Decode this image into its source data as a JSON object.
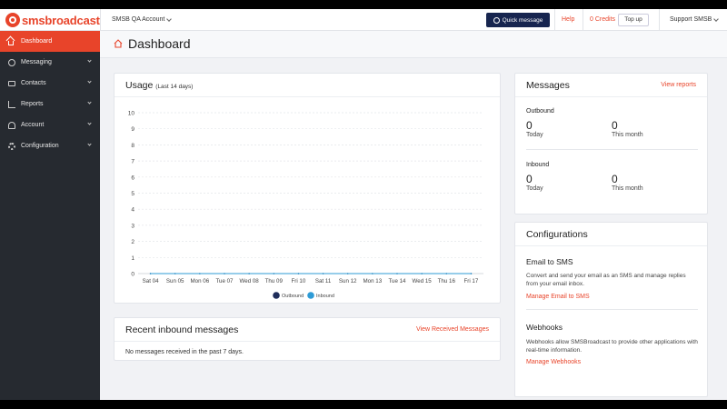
{
  "topbar": {
    "logo_sms": "sms",
    "logo_rest": "broadcast",
    "account": "SMSB QA Account",
    "quick_message": "Quick message",
    "help": "Help",
    "credits": "0 Credits",
    "top_up": "Top up",
    "support": "Support SMSB"
  },
  "sidebar": {
    "items": [
      {
        "label": "Dashboard",
        "icon": "home-icon"
      },
      {
        "label": "Messaging",
        "icon": "message-icon"
      },
      {
        "label": "Contacts",
        "icon": "contacts-icon"
      },
      {
        "label": "Reports",
        "icon": "reports-icon"
      },
      {
        "label": "Account",
        "icon": "user-icon"
      },
      {
        "label": "Configuration",
        "icon": "gear-icon"
      }
    ]
  },
  "page": {
    "title": "Dashboard"
  },
  "usage": {
    "title": "Usage",
    "subtitle": "(Last 14 days)"
  },
  "chart_data": {
    "type": "line",
    "x": [
      "Sat 04",
      "Sun 05",
      "Mon 06",
      "Tue 07",
      "Wed 08",
      "Thu 09",
      "Fri 10",
      "Sat 11",
      "Sun 12",
      "Mon 13",
      "Tue 14",
      "Wed 15",
      "Thu 16",
      "Fri 17"
    ],
    "series": [
      {
        "name": "Outbound",
        "values": [
          0,
          0,
          0,
          0,
          0,
          0,
          0,
          0,
          0,
          0,
          0,
          0,
          0,
          0
        ],
        "color": "#1f2d5a"
      },
      {
        "name": "Inbound",
        "values": [
          0,
          0,
          0,
          0,
          0,
          0,
          0,
          0,
          0,
          0,
          0,
          0,
          0,
          0
        ],
        "color": "#2e9bd6"
      }
    ],
    "ylim": [
      0,
      10
    ],
    "yticks": [
      "0",
      "1",
      "2",
      "3",
      "4",
      "5",
      "6",
      "7",
      "8",
      "9",
      "10"
    ],
    "grid": true,
    "legend": "bottom"
  },
  "recent": {
    "title": "Recent inbound messages",
    "link": "View Received Messages",
    "empty": "No messages received in the past 7 days."
  },
  "messages": {
    "title": "Messages",
    "link": "View reports",
    "outbound": {
      "label": "Outbound",
      "today": "0",
      "today_label": "Today",
      "month": "0",
      "month_label": "This month"
    },
    "inbound": {
      "label": "Inbound",
      "today": "0",
      "today_label": "Today",
      "month": "0",
      "month_label": "This month"
    }
  },
  "configs": {
    "title": "Configurations",
    "email": {
      "title": "Email to SMS",
      "desc": "Convert and send your email as an SMS and manage replies from your email inbox.",
      "link": "Manage Email to SMS"
    },
    "webhooks": {
      "title": "Webhooks",
      "desc": "Webhooks allow SMSBroadcast to provide other applications with real-time information.",
      "link": "Manage Webhooks"
    }
  },
  "colors": {
    "accent": "#e8442a",
    "sidebar": "#262a30",
    "primary": "#17254f"
  }
}
